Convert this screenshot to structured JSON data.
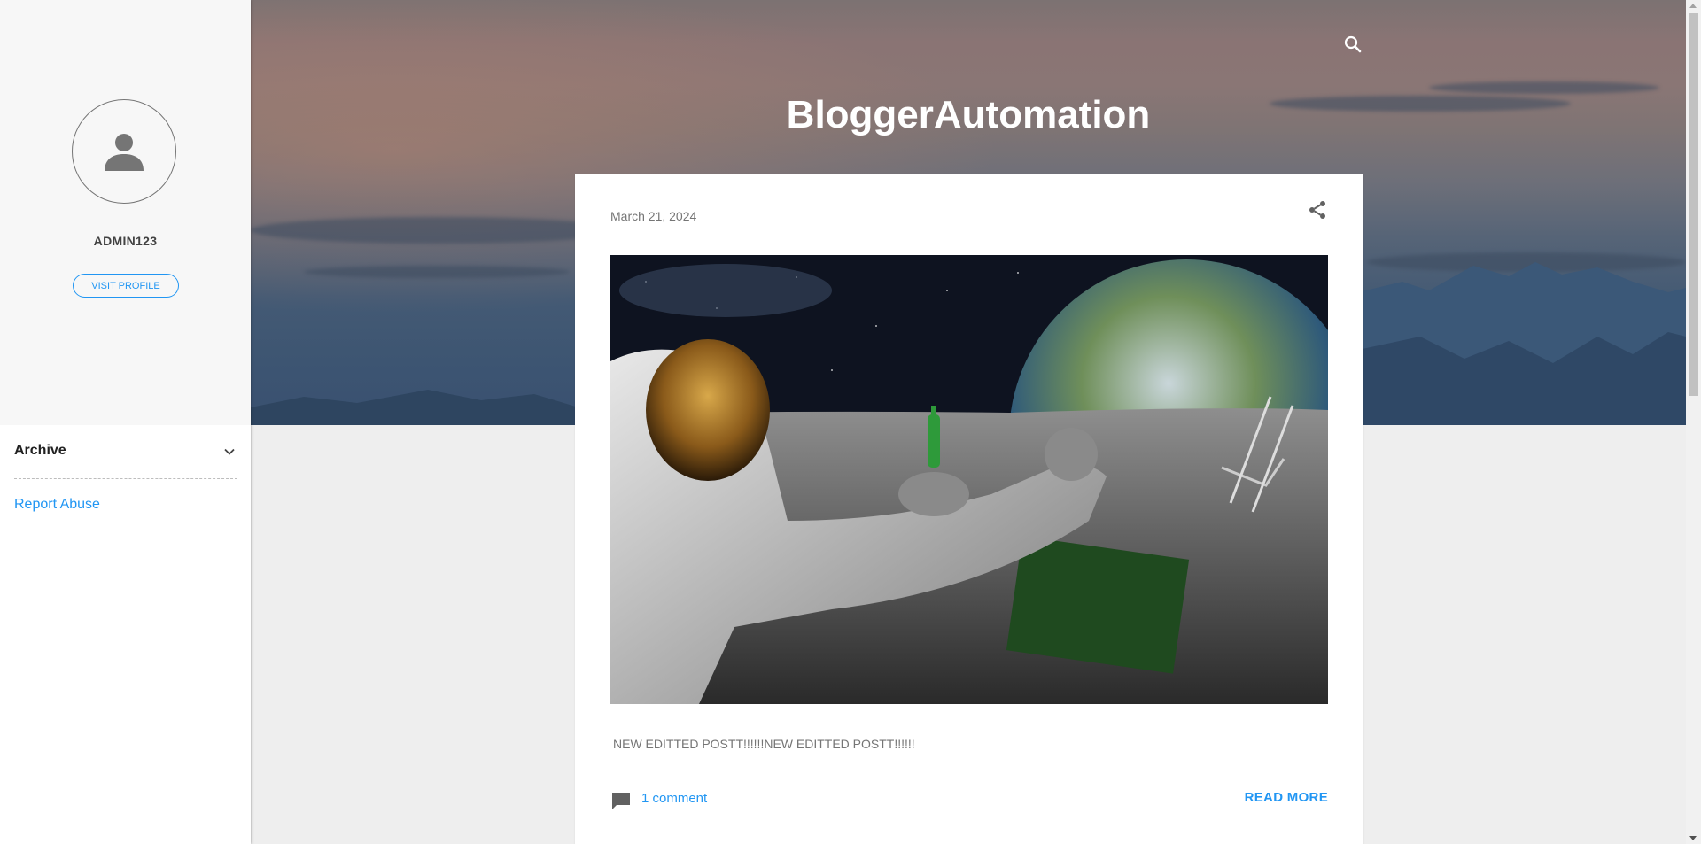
{
  "blog": {
    "title": "BloggerAutomation"
  },
  "header": {
    "search_icon": "search-icon"
  },
  "profile": {
    "name": "ADMIN123",
    "visit_profile_label": "VISIT PROFILE",
    "avatar_icon": "person-icon"
  },
  "sidebar": {
    "archive_label": "Archive",
    "archive_icon": "chevron-down-icon",
    "report_abuse_label": "Report Abuse"
  },
  "post": {
    "date": "March 21, 2024",
    "share_icon": "share-icon",
    "image_alt": "Astronaut with bottle on the moon",
    "snippet": "NEW EDITTED POSTT!!!!!!NEW EDITTED POSTT!!!!!!",
    "comment_icon": "comment-icon",
    "comment_label": "1 comment",
    "read_more_label": "READ MORE"
  },
  "colors": {
    "accent": "#2196f3",
    "sidebar_bg": "#f7f7f7",
    "page_bg": "#eeeeee",
    "title_text": "#ffffff"
  }
}
